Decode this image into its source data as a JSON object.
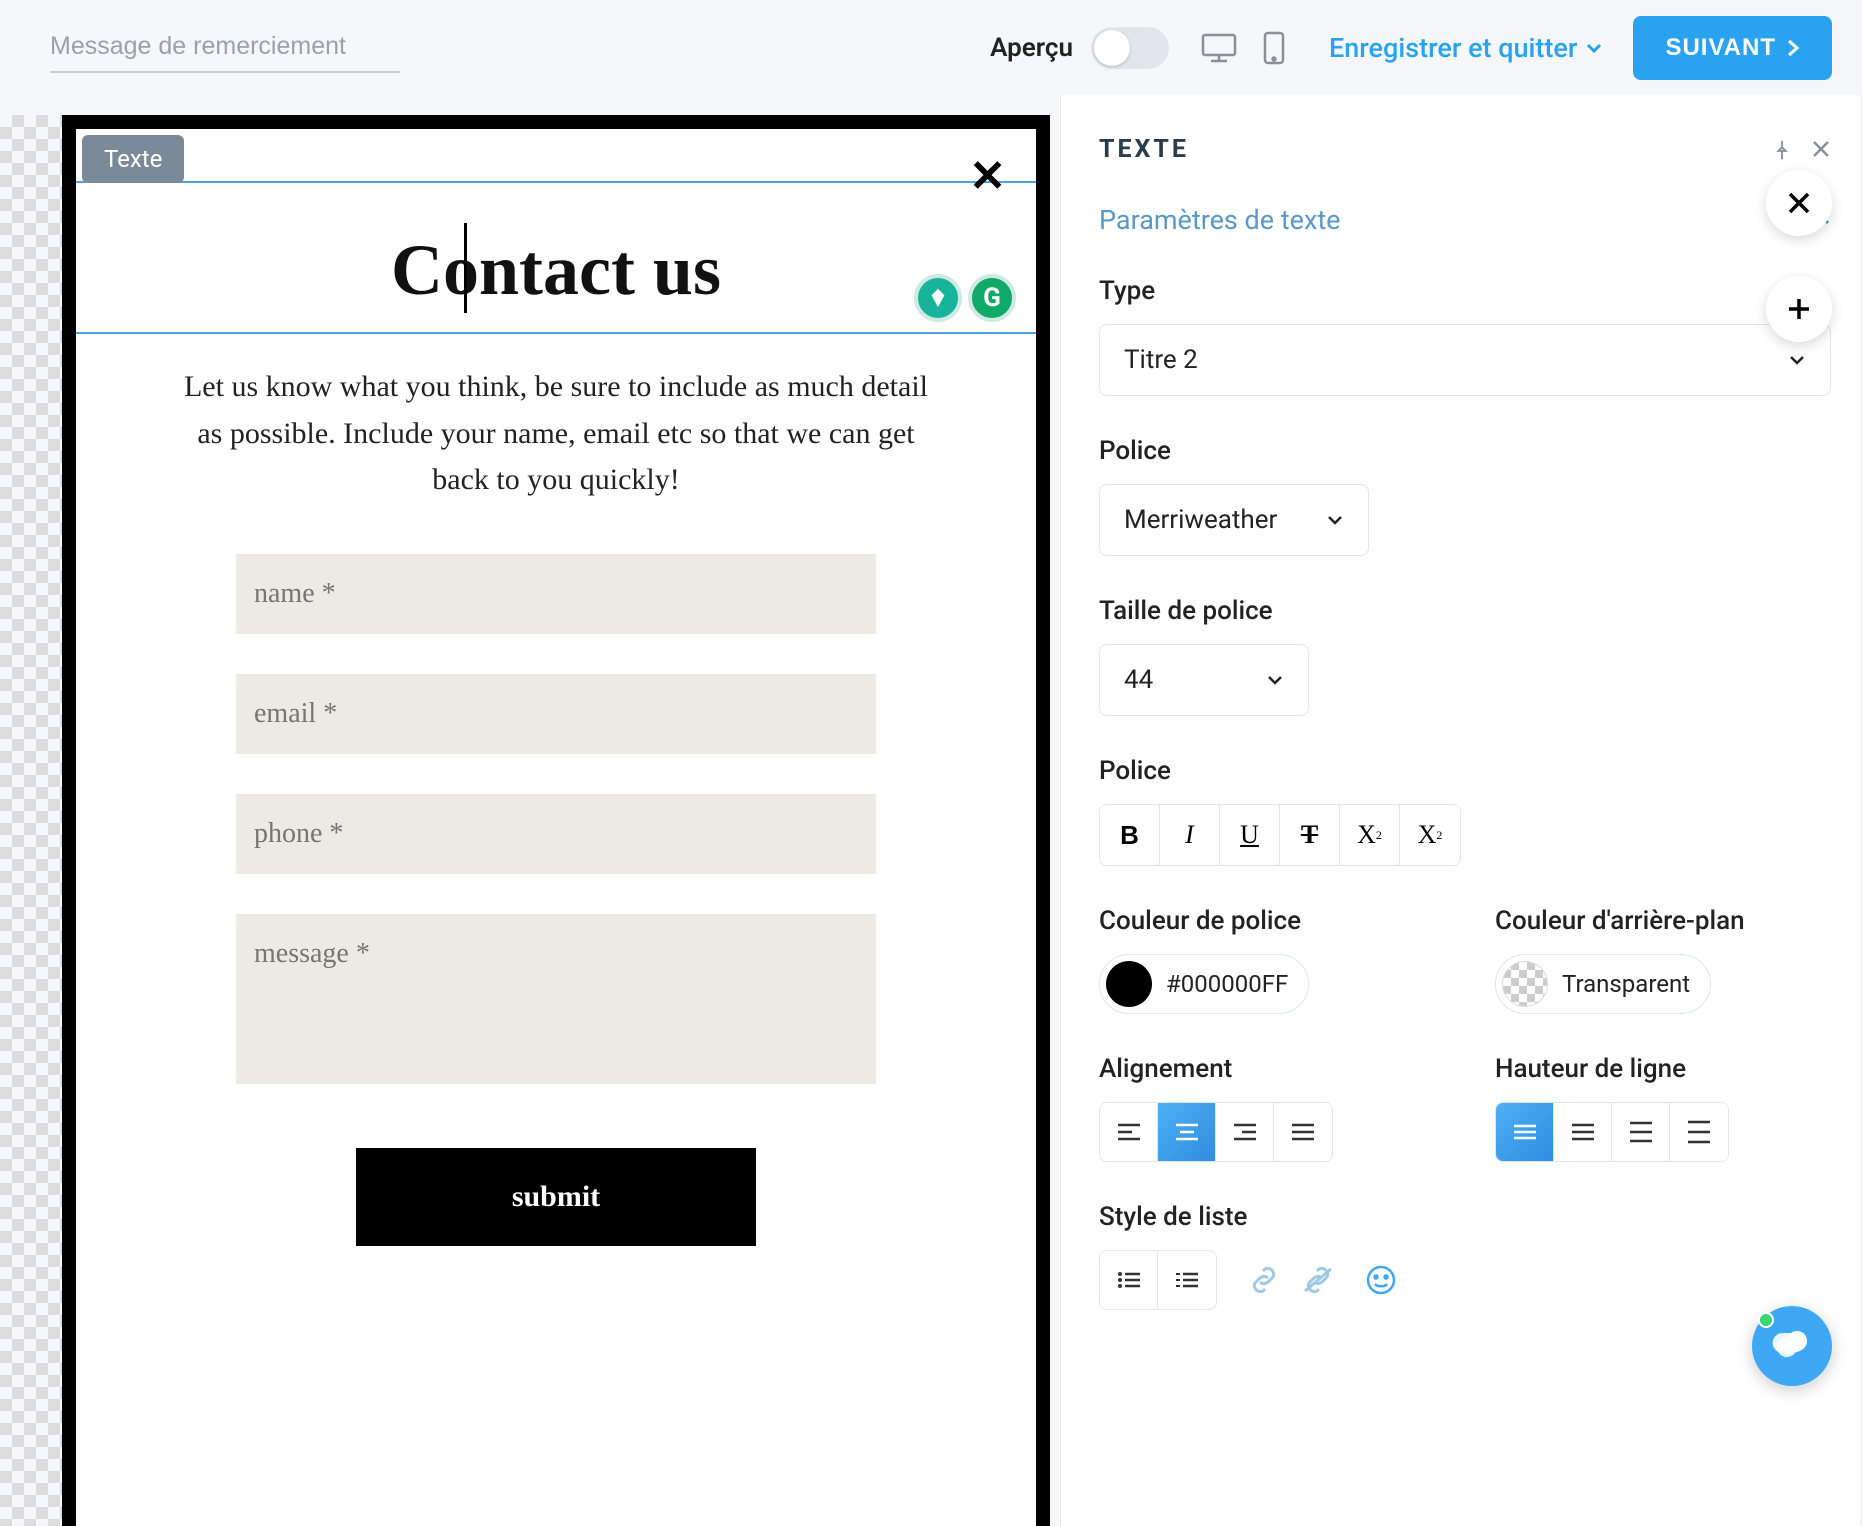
{
  "topbar": {
    "thankyou_placeholder": "Message de remerciement",
    "apercu": "Aperçu",
    "save_exit": "Enregistrer et quitter",
    "next": "SUIVANT"
  },
  "canvas": {
    "tag": "Texte",
    "title": "Contact us",
    "description": "Let us know what you think, be sure to include as much detail as possible. Include your name, email etc so that we can get back to you quickly!",
    "fields": {
      "name": "name *",
      "email": "email *",
      "phone": "phone *",
      "message": "message *"
    },
    "submit": "submit"
  },
  "sidebar": {
    "title": "TEXTE",
    "section": "Paramètres de texte",
    "type": {
      "label": "Type",
      "value": "Titre 2"
    },
    "font": {
      "label": "Police",
      "value": "Merriweather"
    },
    "fontsize": {
      "label": "Taille de police",
      "value": "44"
    },
    "style": {
      "label": "Police"
    },
    "fontcolor": {
      "label": "Couleur de police",
      "value": "#000000FF"
    },
    "bgcolor": {
      "label": "Couleur d'arrière-plan",
      "value": "Transparent"
    },
    "align": {
      "label": "Alignement"
    },
    "lineheight": {
      "label": "Hauteur de ligne"
    },
    "liststyle": {
      "label": "Style de liste"
    }
  }
}
